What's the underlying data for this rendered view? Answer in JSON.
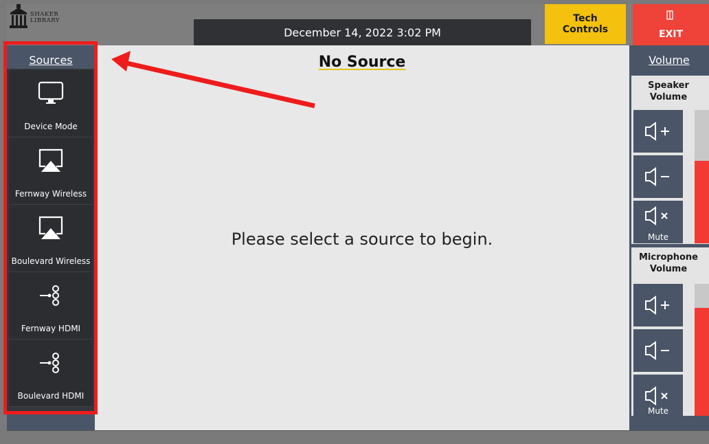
{
  "header": {
    "logo_line1": "SHAKER",
    "logo_line2": "LIBRARY",
    "datetime": "December 14, 2022 3:02 PM",
    "tech_label_1": "Tech",
    "tech_label_2": "Controls",
    "exit_label": "EXIT"
  },
  "sources": {
    "title": "Sources",
    "items": [
      {
        "label": "Device Mode",
        "icon": "monitor-icon"
      },
      {
        "label": "Fernway Wireless",
        "icon": "airplay-icon"
      },
      {
        "label": "Boulevard Wireless",
        "icon": "airplay-icon"
      },
      {
        "label": "Fernway HDMI",
        "icon": "hdmi-input-icon"
      },
      {
        "label": "Boulevard HDMI",
        "icon": "hdmi-input-icon"
      }
    ]
  },
  "main": {
    "title": "No Source",
    "prompt": "Please select a source to begin."
  },
  "volume": {
    "title": "Volume",
    "speaker": {
      "title_1": "Speaker",
      "title_2": "Volume",
      "mute_label": "Mute",
      "level": 0.62
    },
    "microphone": {
      "title_1": "Microphone",
      "title_2": "Volume",
      "mute_label": "Mute",
      "level": 0.82
    }
  },
  "colors": {
    "accent_yellow": "#f3c10e",
    "exit_red": "#ef4238",
    "panel_blue": "#4a5567",
    "highlight_red": "#ee1c1c"
  }
}
